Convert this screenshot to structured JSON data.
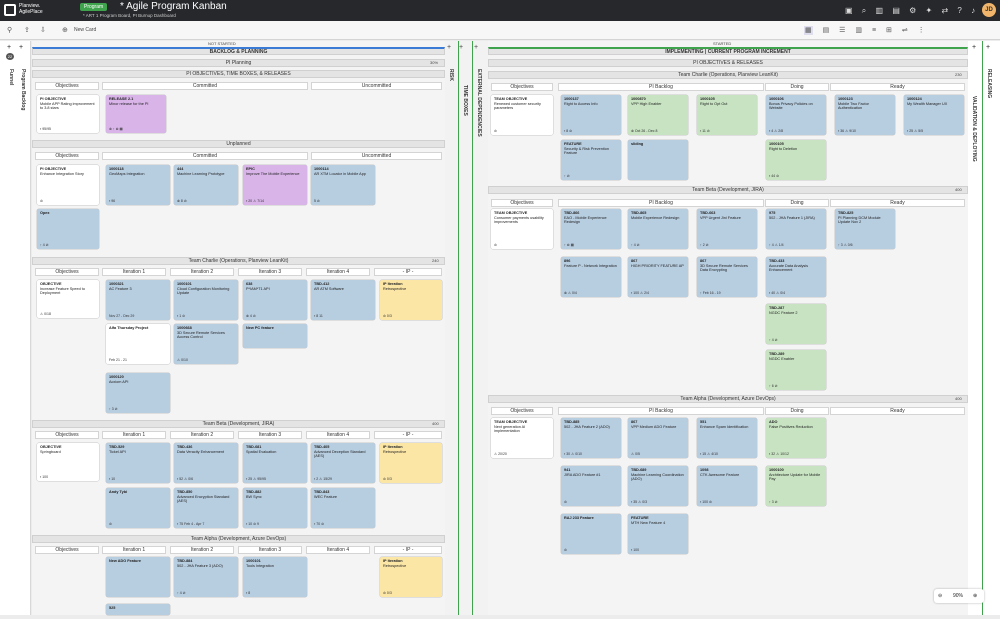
{
  "app": {
    "logo_line1": "Planview.",
    "logo_line2": "AgilePlace",
    "badge": "Program",
    "title": "* Agile Program Kanban",
    "subtitle": "* ART 1 Program Board, PI Burnup Dashboard",
    "avatar": "JD"
  },
  "toolbar": {
    "new_card": "New Card"
  },
  "lanes": {
    "funnel": "Funnel",
    "backlog": "Program Backlog",
    "risk": "RISK",
    "timeboxes": "TIME BOXES",
    "ext": "EXTERNAL DEPENDENCIES",
    "validation": "VALIDATION & DEPLOYING",
    "releasing": "RELEASING",
    "left_count": "22"
  },
  "ns": {
    "top": "NOT STARTED",
    "title": "BACKLOG & PLANNING",
    "pi_planning": "PI Planning",
    "pi_obj": "PI OBJECTIVES, TIME BOXES, & RELEASES",
    "objectives": "Objectives",
    "committed": "Committed",
    "uncommitted": "Uncommitted",
    "unplanned": "Unplanned",
    "team_charlie": "Team Charlie (Operations, Planview LeanKit)",
    "team_beta": "Team Beta (Development, JIRA)",
    "team_alpha": "Team Alpha (Development, Azure DevOps)",
    "it1": "Iteration 1",
    "it2": "Iteration 2",
    "it3": "Iteration 3",
    "it4": "Iteration 4",
    "ip": "- IP -",
    "count1": "30%",
    "count2": "240",
    "count3": "400"
  },
  "st": {
    "top": "STARTED",
    "title": "IMPLEMENTING | CURRENT PROGRAM INCREMENT",
    "pi_obj": "PI OBJECTIVES & RELEASES",
    "objectives": "Objectives",
    "backlog": "PI Backlog",
    "doing": "Doing",
    "ready": "Ready",
    "team_charlie": "Team Charlie (Operations, Planview LeanKit)",
    "team_beta": "Team Beta (Development, JIRA)",
    "team_alpha": "Team Alpha (Development, Azure DevOps)",
    "count_c": "230",
    "count_b": "400",
    "count_a": "400"
  },
  "ns_cards": [
    {
      "id": "ns1",
      "c": "white",
      "l": "PI OBJECTIVE",
      "t": "Mobile APP Rating improvement to 3.8 stars",
      "f": "▪ 95/95"
    },
    {
      "id": "ns2",
      "c": "purple",
      "l": "RELEASE 2.1",
      "t": "Minor release for the PI",
      "f": "⊗ ↑ ⊗ ▦"
    },
    {
      "id": "ns3",
      "c": "white",
      "l": "PI OBJECTIVE",
      "t": "Enhance Integration Story",
      "f": "⊘"
    },
    {
      "id": "ns4",
      "c": "blue",
      "l": "1000118",
      "t": "GeoMaps Integration",
      "f": "▪ 96"
    },
    {
      "id": "ns5",
      "c": "blue",
      "l": "444",
      "t": "Machine Learning Prototype",
      "f": "⊗ 8 ⊘"
    },
    {
      "id": "ns6",
      "c": "purple",
      "l": "EPIC",
      "t": "Improve The Mobile Experience",
      "f": "▪ 20 ⚠ 7/14"
    },
    {
      "id": "ns7",
      "c": "blue",
      "l": "1000114",
      "t": "AR XTM Locator in Mobile App",
      "f": "5 ⊘"
    },
    {
      "id": "ns8",
      "c": "blue",
      "l": "Opex",
      "t": "",
      "f": "↑ 4 ⊘"
    },
    {
      "id": "ns9",
      "c": "white",
      "l": "OBJECTIVE",
      "t": "Increase Feature Speed to Deployment",
      "f": "⚠ 0/18"
    },
    {
      "id": "ns10",
      "c": "blue",
      "l": "1000321",
      "t": "AC Feature 3",
      "f": "Nov 27 - Dec 29"
    },
    {
      "id": "ns11",
      "c": "blue",
      "l": "1000101",
      "t": "Cloud Configuration Monitoring Update",
      "f": "▪ 1 ⊘"
    },
    {
      "id": "ns12",
      "c": "blue",
      "l": "638",
      "t": "P*IAM*T1 API",
      "f": "⊗ 4 ⊘"
    },
    {
      "id": "ns13",
      "c": "blue",
      "l": "TBD-412",
      "t": "AR ATM Software",
      "f": "▪ 8 11"
    },
    {
      "id": "ns14",
      "c": "yellow",
      "l": "IP Iteration",
      "t": "Retrospective",
      "f": "⊘ 0/3"
    },
    {
      "id": "ns15",
      "c": "white",
      "l": "Alfa Thursday Project",
      "t": "",
      "f": "Feb 21 - 21"
    },
    {
      "id": "ns16",
      "c": "blue",
      "l": "1000668",
      "t": "3D Secure Remote Services Access Control",
      "f": "⚠ 0/10"
    },
    {
      "id": "ns17",
      "c": "blue",
      "l": "New PC feature",
      "t": "",
      "f": ""
    },
    {
      "id": "ns18",
      "c": "blue",
      "l": "1000120",
      "t": "Acxiom API",
      "f": "↑ 3 ⊘"
    },
    {
      "id": "ns19",
      "c": "white",
      "l": "OBJECTIVE",
      "t": "Springboard",
      "f": "▪ 100"
    },
    {
      "id": "ns20",
      "c": "blue",
      "l": "TBD-529",
      "t": "Tickel API",
      "f": "▪ 10"
    },
    {
      "id": "ns21",
      "c": "blue",
      "l": "TBD-436",
      "t": "Data Veracity Enhancement",
      "f": "▪ 52 ⚠ 0/6"
    },
    {
      "id": "ns22",
      "c": "blue",
      "l": "TBD-681",
      "t": "Spatial Evaluation",
      "f": "▪ 25 ⚠ 95/95"
    },
    {
      "id": "ns23",
      "c": "blue",
      "l": "TBD-405",
      "t": "Advanced Deception Standard (AES)",
      "f": "▪ 2 ⚠ 15/29"
    },
    {
      "id": "ns24",
      "c": "yellow",
      "l": "IP Iteration",
      "t": "Retrospective",
      "f": "⊘ 0/3"
    },
    {
      "id": "ns25",
      "c": "blue",
      "l": "Andy Tybi",
      "t": "",
      "f": "⊘"
    },
    {
      "id": "ns26",
      "c": "blue",
      "l": "TBD-850",
      "t": "Advanced Encryption Standard (AES)",
      "f": "▪ 75 Feb 4 - Apr 7"
    },
    {
      "id": "ns27",
      "c": "blue",
      "l": "TBD-882",
      "t": "BW Sync",
      "f": "▪ 10 ⊘ 9"
    },
    {
      "id": "ns28",
      "c": "blue",
      "l": "TBD-843",
      "t": "WEC Feature",
      "f": "▪ 70 ⊘"
    },
    {
      "id": "ns29",
      "c": "blue",
      "l": "New ADO Feature",
      "t": "",
      "f": ""
    },
    {
      "id": "ns30",
      "c": "blue",
      "l": "TBD-884",
      "t": "502 - JHA Feature 3 (ADO)",
      "f": "↑ 4 ⊘"
    },
    {
      "id": "ns31",
      "c": "blue",
      "l": "1000101",
      "t": "Tools Integration",
      "f": "▪ 8"
    },
    {
      "id": "ns32",
      "c": "yellow",
      "l": "IP Iteration",
      "t": "Retrospective",
      "f": "⊘ 0/3"
    },
    {
      "id": "ns33",
      "c": "blue",
      "l": "525",
      "t": "",
      "f": ""
    }
  ],
  "st_cards": [
    {
      "id": "s1",
      "c": "white",
      "l": "TEAM OBJECTIVE",
      "t": "Renewed customer security parameters",
      "f": "⊘"
    },
    {
      "id": "s2",
      "c": "blue",
      "l": "1000137",
      "t": "Right to Access Info",
      "f": "▪ 8 ⊘"
    },
    {
      "id": "s3",
      "c": "green",
      "l": "1000870",
      "t": "VPP High Enabler",
      "f": "⊗ Oct 26 - Dec 8"
    },
    {
      "id": "s4",
      "c": "green",
      "l": "1000105",
      "t": "Right to Opt Out",
      "f": "▪ 11 ⊘"
    },
    {
      "id": "s5",
      "c": "blue",
      "l": "1000123",
      "t": "Mobile Two Factor Authentication",
      "f": "▪ 36 ⚠ 9/10"
    },
    {
      "id": "s6",
      "c": "blue",
      "l": "1000124",
      "t": "My Wealth Manager UX",
      "f": "▪ 25 ⚠ 5/5"
    },
    {
      "id": "s7",
      "c": "blue",
      "l": "1000106",
      "t": "Bonus Privacy Policies on Website",
      "f": "▪ 4 ⚠ 2/8"
    },
    {
      "id": "s8",
      "c": "blue",
      "l": "FEATURE",
      "t": "Security & Risk Prevention Feature",
      "f": "↑ ⊘"
    },
    {
      "id": "s9",
      "c": "blue",
      "l": "sliding",
      "t": "",
      "f": ""
    },
    {
      "id": "s10",
      "c": "green",
      "l": "1000105",
      "t": "Right to Deletion",
      "f": "▪ 44 ⊘"
    },
    {
      "id": "s11",
      "c": "white",
      "l": "TEAM OBJECTIVE",
      "t": "Consumer payments usability improvements",
      "f": "⊘"
    },
    {
      "id": "s12",
      "c": "blue",
      "l": "TBD-866",
      "t": "EAO - Mobile Experience Redesign",
      "f": "↑ ⊗ ▦"
    },
    {
      "id": "s13",
      "c": "blue",
      "l": "TBD-865",
      "t": "Mobile Experience Redesign",
      "f": "↑ 4 ⊘"
    },
    {
      "id": "s14",
      "c": "blue",
      "l": "TBD-663",
      "t": "VPP Urgent Jini Feature",
      "f": "↑ 2 ⊘"
    },
    {
      "id": "s15",
      "c": "blue",
      "l": "975",
      "t": "502 - JHA Feature 1 (JIRA)",
      "f": "↑ 4 ⚠ 1/4"
    },
    {
      "id": "s16",
      "c": "blue",
      "l": "TBD-825",
      "t": "PI Planning DCM Module Update Nov 2",
      "f": "↑ 3 ⚠ 0/6"
    },
    {
      "id": "s17",
      "c": "blue",
      "l": "896",
      "t": "Feature P - Network Integration",
      "f": "⊗ ⚠ 0/4"
    },
    {
      "id": "s18",
      "c": "blue",
      "l": "867",
      "t": "HIGH PRIORITY FEATURE AP",
      "f": "▪ 100 ⚠ 2/4"
    },
    {
      "id": "s19",
      "c": "blue",
      "l": "867",
      "t": "3D Secure Remote Services Data Encrypting",
      "f": "↑ Feb 16 - 19"
    },
    {
      "id": "s20",
      "c": "blue",
      "l": "TBD-433",
      "t": "Accurate Data Analysis Enhancement",
      "f": "▪ 40 ⚠ 0/4"
    },
    {
      "id": "s21",
      "c": "green",
      "l": "TBD-287",
      "t": "NGDC Feature 2",
      "f": "↑ 4 ⊘"
    },
    {
      "id": "s22",
      "c": "green",
      "l": "TBD-289",
      "t": "NGDC Enabler",
      "f": "↑ 6 ⊘"
    },
    {
      "id": "s23",
      "c": "white",
      "l": "TEAM OBJECTIVE",
      "t": "Next generation AI implementation",
      "f": "⚠ 20/20"
    },
    {
      "id": "s24",
      "c": "blue",
      "l": "TBD-885",
      "t": "502 - JHA Feature 2 (ADO)",
      "f": "▪ 30 ⚠ 0/10"
    },
    {
      "id": "s25",
      "c": "blue",
      "l": "867",
      "t": "VPP Medium ADO Feature",
      "f": "⚠ 0/5"
    },
    {
      "id": "s26",
      "c": "blue",
      "l": "551",
      "t": "Enhance Spam Identification",
      "f": "▪ 15 ⚠ 4/10"
    },
    {
      "id": "s27",
      "c": "green",
      "l": "ADO",
      "t": "False Positives Reduction",
      "f": "▪ 32 ⚠ 10/12"
    },
    {
      "id": "s28",
      "c": "blue",
      "l": "941",
      "t": "JIRA ADO Feature #1",
      "f": "⊘"
    },
    {
      "id": "s29",
      "c": "blue",
      "l": "TBD-689",
      "t": "Machine Learning Coordination (ADO)",
      "f": "▪ 35 ⚠ 0/3"
    },
    {
      "id": "s30",
      "c": "blue",
      "l": "1098",
      "t": "CTK Awesome Feature",
      "f": "▪ 100 ⊘"
    },
    {
      "id": "s31",
      "c": "green",
      "l": "1000100",
      "t": "Architecture Update for Mobile Pay",
      "f": "↑ 3 ⊘"
    },
    {
      "id": "s32",
      "c": "blue",
      "l": "RAJ 233 Feature",
      "t": "",
      "f": "⊘"
    },
    {
      "id": "s33",
      "c": "blue",
      "l": "FEATURE",
      "t": "MTH New Feature 4",
      "f": "▪ 100"
    }
  ],
  "zoom": "90%"
}
